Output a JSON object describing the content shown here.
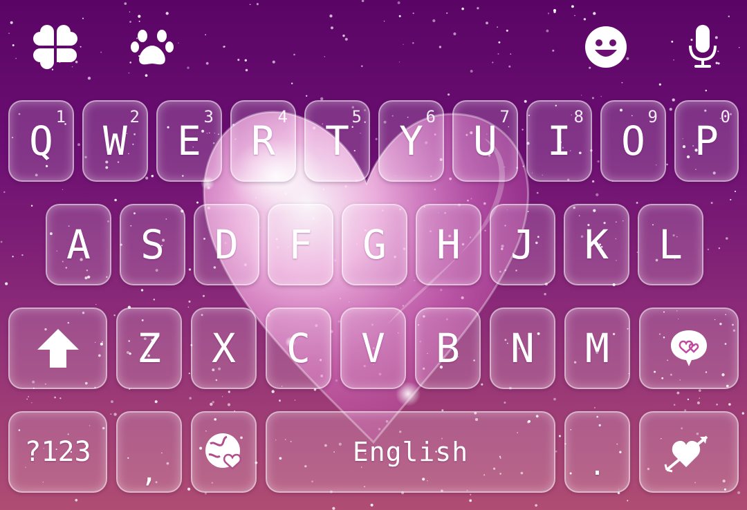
{
  "theme": {
    "background_top": "#5a0566",
    "background_bottom": "#b04d73",
    "key_fill": "rgba(255,255,255,0.16)",
    "key_border": "rgba(255,255,255,0.55)",
    "text_color": "#ffffff",
    "background_art": "glossy-pink-heart"
  },
  "toolbar": {
    "left": [
      {
        "name": "clover-icon",
        "icon": "four-leaf-clover"
      },
      {
        "name": "paw-icon",
        "icon": "paw-print"
      }
    ],
    "right": [
      {
        "name": "emoji-icon",
        "icon": "smiley-face"
      },
      {
        "name": "microphone-icon",
        "icon": "microphone"
      }
    ]
  },
  "keyboard": {
    "row1": [
      {
        "label": "Q",
        "hint": "1"
      },
      {
        "label": "W",
        "hint": "2"
      },
      {
        "label": "E",
        "hint": "3"
      },
      {
        "label": "R",
        "hint": "4"
      },
      {
        "label": "T",
        "hint": "5"
      },
      {
        "label": "Y",
        "hint": "6"
      },
      {
        "label": "U",
        "hint": "7"
      },
      {
        "label": "I",
        "hint": "8"
      },
      {
        "label": "O",
        "hint": "9"
      },
      {
        "label": "P",
        "hint": "0"
      }
    ],
    "row2": [
      {
        "label": "A"
      },
      {
        "label": "S"
      },
      {
        "label": "D"
      },
      {
        "label": "F"
      },
      {
        "label": "G"
      },
      {
        "label": "H"
      },
      {
        "label": "J"
      },
      {
        "label": "K"
      },
      {
        "label": "L"
      }
    ],
    "row3": {
      "shift_icon": "shift-arrow-icon",
      "letters": [
        {
          "label": "Z"
        },
        {
          "label": "X"
        },
        {
          "label": "C"
        },
        {
          "label": "V"
        },
        {
          "label": "B"
        },
        {
          "label": "N"
        },
        {
          "label": "M"
        }
      ],
      "action_icon": "heart-chat-bubble-icon"
    },
    "row4": {
      "symbols_label": "?123",
      "comma_label": ",",
      "globe_icon": "globe-heart-icon",
      "space_label": "English",
      "period_label": ".",
      "enter_icon": "heart-arrow-icon"
    }
  }
}
